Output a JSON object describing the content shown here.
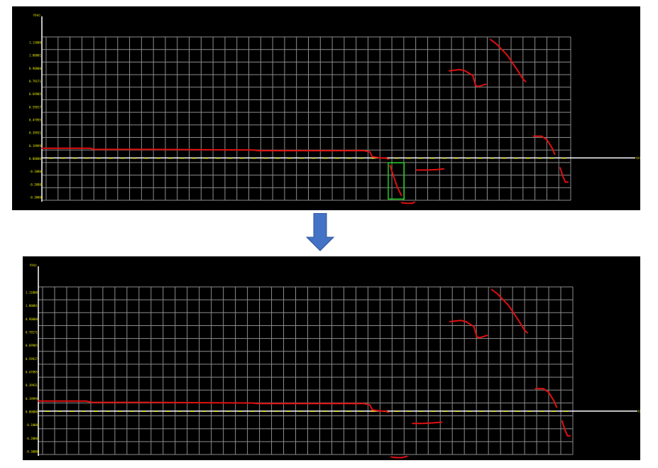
{
  "colors": {
    "background": "#000000",
    "grid": "#8c8c8c",
    "axis": "#ffffff",
    "tick_label": "#e8e800",
    "data": "#e01010",
    "highlight_box": "#22cc22",
    "arrow": "#4472c4",
    "page": "#ffffff"
  },
  "icons": {
    "transition": "down-arrow-icon"
  },
  "chart_data": [
    {
      "type": "line",
      "panel": "before",
      "y_axis_unit": "f(Hz)",
      "x_axis_unit": "t(ms)",
      "ylim": [
        -0.35,
        1.0
      ],
      "yticks": [
        "1.11000",
        "1.00001",
        "0.90000",
        "0.79171",
        "0.69985",
        "0.59917",
        "0.47995",
        "0.39931",
        "0.19999",
        "0.00000",
        "-0.10001",
        "-0.20001",
        "-0.30000"
      ],
      "grid": true,
      "highlight": {
        "x_range": [
          0.655,
          0.685
        ],
        "y_range": [
          -0.34,
          -0.04
        ],
        "note": "green box"
      },
      "series": [
        {
          "points": [
            [
              0.0,
              0.08
            ],
            [
              0.09,
              0.08
            ],
            [
              0.1,
              0.07
            ],
            [
              0.11,
              0.07
            ],
            [
              0.2,
              0.07
            ],
            [
              0.4,
              0.065
            ],
            [
              0.41,
              0.06
            ],
            [
              0.6,
              0.06
            ],
            [
              0.61,
              0.06
            ],
            [
              0.62,
              0.05
            ],
            [
              0.625,
              0.01
            ],
            [
              0.64,
              0.0
            ],
            [
              0.65,
              0.0
            ],
            [
              0.655,
              -0.01
            ]
          ]
        },
        {
          "points": [
            [
              0.658,
              -0.06
            ],
            [
              0.665,
              -0.15
            ],
            [
              0.672,
              -0.24
            ],
            [
              0.68,
              -0.31
            ]
          ]
        },
        {
          "points": [
            [
              0.68,
              -0.37
            ],
            [
              0.69,
              -0.375
            ],
            [
              0.7,
              -0.375
            ],
            [
              0.705,
              -0.365
            ]
          ]
        },
        {
          "points": [
            [
              0.708,
              -0.1
            ],
            [
              0.73,
              -0.1
            ],
            [
              0.75,
              -0.095
            ],
            [
              0.76,
              -0.09
            ]
          ]
        },
        {
          "points": [
            [
              0.77,
              0.72
            ],
            [
              0.79,
              0.73
            ],
            [
              0.8,
              0.72
            ],
            [
              0.815,
              0.68
            ],
            [
              0.82,
              0.6
            ],
            [
              0.825,
              0.59
            ],
            [
              0.84,
              0.61
            ]
          ]
        },
        {
          "points": [
            [
              0.848,
              0.98
            ],
            [
              0.86,
              0.94
            ],
            [
              0.88,
              0.85
            ],
            [
              0.9,
              0.72
            ],
            [
              0.91,
              0.65
            ],
            [
              0.915,
              0.63
            ]
          ]
        },
        {
          "points": [
            [
              0.93,
              0.18
            ],
            [
              0.945,
              0.18
            ],
            [
              0.955,
              0.15
            ],
            [
              0.965,
              0.08
            ],
            [
              0.97,
              0.03
            ]
          ]
        },
        {
          "points": [
            [
              0.98,
              -0.08
            ],
            [
              0.985,
              -0.15
            ],
            [
              0.99,
              -0.2
            ],
            [
              0.995,
              -0.2
            ]
          ]
        }
      ]
    },
    {
      "type": "line",
      "panel": "after",
      "y_axis_unit": "f(Hz)",
      "x_axis_unit": "t(ms)",
      "ylim": [
        -0.35,
        1.0
      ],
      "yticks": [
        "1.11000",
        "1.00001",
        "0.90000",
        "0.79171",
        "0.69985",
        "0.59917",
        "0.47995",
        "0.39931",
        "0.19999",
        "0.00000",
        "-0.10001",
        "-0.20001",
        "-0.30000"
      ],
      "grid": true,
      "series": [
        {
          "points": [
            [
              0.0,
              0.08
            ],
            [
              0.09,
              0.08
            ],
            [
              0.1,
              0.07
            ],
            [
              0.11,
              0.07
            ],
            [
              0.2,
              0.07
            ],
            [
              0.4,
              0.065
            ],
            [
              0.41,
              0.06
            ],
            [
              0.6,
              0.06
            ],
            [
              0.61,
              0.06
            ],
            [
              0.62,
              0.05
            ],
            [
              0.625,
              0.01
            ],
            [
              0.64,
              0.0
            ],
            [
              0.65,
              0.0
            ],
            [
              0.655,
              -0.01
            ]
          ]
        },
        {
          "points": [
            [
              0.66,
              -0.37
            ],
            [
              0.67,
              -0.375
            ],
            [
              0.68,
              -0.375
            ],
            [
              0.69,
              -0.365
            ]
          ]
        },
        {
          "points": [
            [
              0.7,
              -0.1
            ],
            [
              0.72,
              -0.1
            ],
            [
              0.74,
              -0.095
            ],
            [
              0.755,
              -0.09
            ]
          ]
        },
        {
          "points": [
            [
              0.77,
              0.72
            ],
            [
              0.79,
              0.73
            ],
            [
              0.8,
              0.72
            ],
            [
              0.815,
              0.68
            ],
            [
              0.82,
              0.6
            ],
            [
              0.825,
              0.59
            ],
            [
              0.84,
              0.61
            ]
          ]
        },
        {
          "points": [
            [
              0.848,
              0.98
            ],
            [
              0.86,
              0.94
            ],
            [
              0.88,
              0.85
            ],
            [
              0.9,
              0.72
            ],
            [
              0.91,
              0.65
            ],
            [
              0.915,
              0.63
            ]
          ]
        },
        {
          "points": [
            [
              0.93,
              0.18
            ],
            [
              0.945,
              0.18
            ],
            [
              0.955,
              0.15
            ],
            [
              0.965,
              0.08
            ],
            [
              0.97,
              0.03
            ]
          ]
        },
        {
          "points": [
            [
              0.98,
              -0.08
            ],
            [
              0.985,
              -0.15
            ],
            [
              0.99,
              -0.2
            ],
            [
              0.995,
              -0.2
            ]
          ]
        }
      ]
    }
  ]
}
